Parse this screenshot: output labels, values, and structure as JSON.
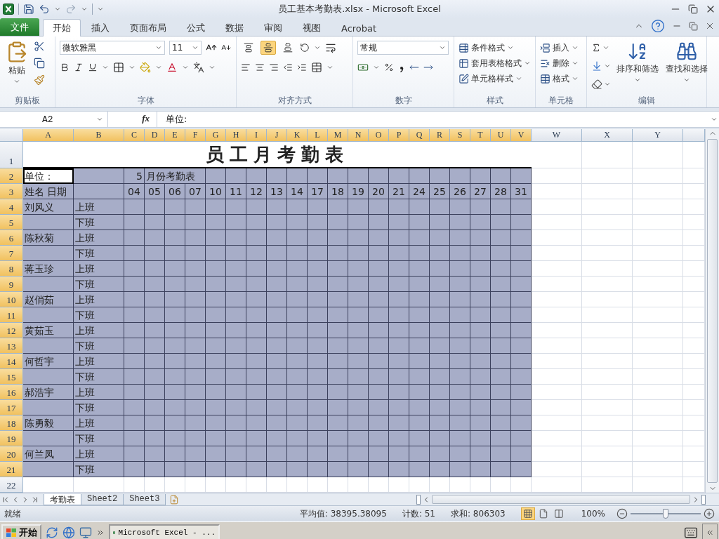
{
  "window": {
    "title": "员工基本考勤表.xlsx - Microsoft Excel"
  },
  "ribbon_tabs": [
    {
      "label": "文件",
      "kind": "file",
      "selected": false
    },
    {
      "label": "开始",
      "kind": "tab",
      "selected": true
    },
    {
      "label": "插入",
      "kind": "tab",
      "selected": false
    },
    {
      "label": "页面布局",
      "kind": "tab",
      "selected": false
    },
    {
      "label": "公式",
      "kind": "tab",
      "selected": false
    },
    {
      "label": "数据",
      "kind": "tab",
      "selected": false
    },
    {
      "label": "审阅",
      "kind": "tab",
      "selected": false
    },
    {
      "label": "视图",
      "kind": "tab",
      "selected": false
    },
    {
      "label": "Acrobat",
      "kind": "tab",
      "selected": false
    }
  ],
  "ribbon": {
    "clipboard": {
      "paste": "粘贴",
      "group": "剪贴板"
    },
    "font": {
      "name": "微软雅黑",
      "size": "11",
      "group": "字体"
    },
    "alignment": {
      "vertical": [
        {
          "kind": "top",
          "selected": false
        },
        {
          "kind": "middle",
          "selected": true
        },
        {
          "kind": "bottom",
          "selected": false
        }
      ],
      "group": "对齐方式"
    },
    "number": {
      "format": "常规",
      "group": "数字"
    },
    "styles": {
      "buttons": [
        "条件格式",
        "套用表格格式",
        "单元格样式"
      ],
      "group": "样式"
    },
    "cells": {
      "buttons": [
        "插入",
        "删除",
        "格式"
      ],
      "group": "单元格"
    },
    "editing": {
      "buttons": [
        "排序和筛选",
        "查找和选择"
      ],
      "group": "编辑"
    }
  },
  "formula_bar": {
    "name_box": "A2",
    "function_label": "fx",
    "formula": "单位:"
  },
  "columns": [
    {
      "label": "A",
      "selected": true
    },
    {
      "label": "B",
      "selected": true
    },
    {
      "label": "C",
      "selected": true
    },
    {
      "label": "D",
      "selected": true
    },
    {
      "label": "E",
      "selected": true
    },
    {
      "label": "F",
      "selected": true
    },
    {
      "label": "G",
      "selected": true
    },
    {
      "label": "H",
      "selected": true
    },
    {
      "label": "I",
      "selected": true
    },
    {
      "label": "J",
      "selected": true
    },
    {
      "label": "K",
      "selected": true
    },
    {
      "label": "L",
      "selected": true
    },
    {
      "label": "M",
      "selected": true
    },
    {
      "label": "N",
      "selected": true
    },
    {
      "label": "O",
      "selected": true
    },
    {
      "label": "P",
      "selected": true
    },
    {
      "label": "Q",
      "selected": true
    },
    {
      "label": "R",
      "selected": true
    },
    {
      "label": "S",
      "selected": true
    },
    {
      "label": "T",
      "selected": true
    },
    {
      "label": "U",
      "selected": true
    },
    {
      "label": "V",
      "selected": true
    },
    {
      "label": "W",
      "selected": false
    },
    {
      "label": "X",
      "selected": false
    },
    {
      "label": "Y",
      "selected": false
    }
  ],
  "rows": [
    {
      "label": "1",
      "selected": false
    },
    {
      "label": "2",
      "selected": true
    },
    {
      "label": "3",
      "selected": true
    },
    {
      "label": "4",
      "selected": true
    },
    {
      "label": "5",
      "selected": true
    },
    {
      "label": "6",
      "selected": true
    },
    {
      "label": "7",
      "selected": true
    },
    {
      "label": "8",
      "selected": true
    },
    {
      "label": "9",
      "selected": true
    },
    {
      "label": "10",
      "selected": true
    },
    {
      "label": "11",
      "selected": true
    },
    {
      "label": "12",
      "selected": true
    },
    {
      "label": "13",
      "selected": true
    },
    {
      "label": "14",
      "selected": true
    },
    {
      "label": "15",
      "selected": true
    },
    {
      "label": "16",
      "selected": true
    },
    {
      "label": "17",
      "selected": true
    },
    {
      "label": "18",
      "selected": true
    },
    {
      "label": "19",
      "selected": true
    },
    {
      "label": "20",
      "selected": true
    },
    {
      "label": "21",
      "selected": true
    },
    {
      "label": "22",
      "selected": false
    }
  ],
  "sheet": {
    "title": "员工月考勤表",
    "unit_cell": {
      "text": "单位：",
      "active": true
    },
    "month": "5",
    "month_label": "月份考勤表",
    "name_header": "姓名  日期",
    "days": [
      "04",
      "05",
      "06",
      "07",
      "10",
      "11",
      "12",
      "13",
      "14",
      "17",
      "18",
      "19",
      "20",
      "21",
      "24",
      "25",
      "26",
      "27",
      "28",
      "31"
    ],
    "employees": [
      {
        "name": "刘风义",
        "shifts": [
          "上班",
          "下班"
        ]
      },
      {
        "name": "陈秋菊",
        "shifts": [
          "上班",
          "下班"
        ]
      },
      {
        "name": "蒋玉珍",
        "shifts": [
          "上班",
          "下班"
        ]
      },
      {
        "name": "赵俏茹",
        "shifts": [
          "上班",
          "下班"
        ]
      },
      {
        "name": "黄茹玉",
        "shifts": [
          "上班",
          "下班"
        ]
      },
      {
        "name": "何哲宇",
        "shifts": [
          "上班",
          "下班"
        ]
      },
      {
        "name": "郝浩宇",
        "shifts": [
          "上班",
          "下班"
        ]
      },
      {
        "name": "陈勇毅",
        "shifts": [
          "上班",
          "下班"
        ]
      },
      {
        "name": "何兰凤",
        "shifts": [
          "上班",
          "下班"
        ]
      }
    ]
  },
  "sheet_tabs": [
    {
      "label": "考勤表",
      "selected": true
    },
    {
      "label": "Sheet2",
      "selected": false
    },
    {
      "label": "Sheet3",
      "selected": false
    }
  ],
  "status_bar": {
    "mode": "就绪",
    "average": "平均值: 38395.38095",
    "count": "计数: 51",
    "sum": "求和: 806303",
    "views": [
      {
        "kind": "normal",
        "selected": true
      },
      {
        "kind": "page_layout",
        "selected": false
      },
      {
        "kind": "page_break",
        "selected": false
      }
    ],
    "zoom": "100%",
    "zoom_slider": {
      "level": 0.5
    }
  },
  "taskbar": {
    "start": "开始",
    "windows": [
      {
        "label": "Microsoft Excel - ...",
        "selected": true
      }
    ]
  }
}
